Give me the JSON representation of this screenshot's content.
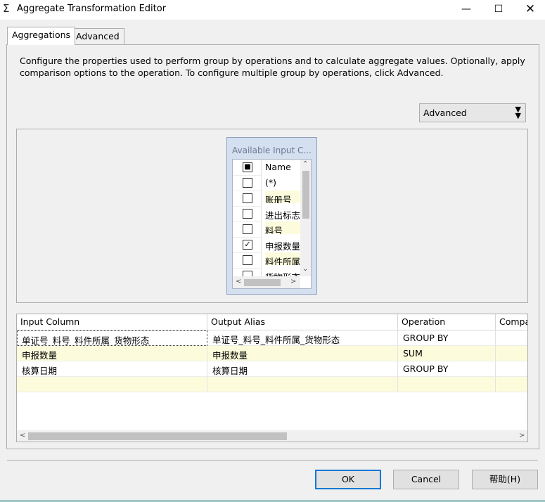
{
  "window": {
    "title": "Aggregate Transformation Editor",
    "icon": "Σ",
    "minimize": "—",
    "maximize": "☐",
    "close": "✕"
  },
  "tabs": [
    {
      "label": "Aggregations",
      "selected": true
    },
    {
      "label": "Advanced",
      "selected": false
    }
  ],
  "description": "Configure the properties used to perform group by operations and to calculate aggregate values. Optionally, apply comparison options to the operation. To configure multiple group by operations, click Advanced.",
  "advanced_toggle": {
    "label": "Advanced",
    "arrow": "▾▾"
  },
  "input_columns": {
    "title": "Available Input C...",
    "header": "Name",
    "rows": [
      {
        "label": "(*)",
        "checked": false
      },
      {
        "label": "账册号",
        "checked": false
      },
      {
        "label": "进出标志",
        "checked": false
      },
      {
        "label": "料号",
        "checked": false
      },
      {
        "label": "申报数量",
        "checked": true
      },
      {
        "label": "料件所属",
        "checked": false
      },
      {
        "label": "货物形态",
        "checked": false
      }
    ]
  },
  "grid": {
    "columns": [
      "Input Column",
      "Output Alias",
      "Operation",
      "Compa"
    ],
    "rows": [
      {
        "input": "单证号_料号_料件所属_货物形态",
        "alias": "单证号_料号_料件所属_货物形态",
        "operation": "GROUP BY"
      },
      {
        "input": "申报数量",
        "alias": "申报数量",
        "operation": "SUM"
      },
      {
        "input": "核算日期",
        "alias": "核算日期",
        "operation": "GROUP BY"
      },
      {
        "input": "",
        "alias": "",
        "operation": ""
      }
    ]
  },
  "buttons": {
    "ok": "OK",
    "cancel": "Cancel",
    "help": "帮助(H)"
  }
}
